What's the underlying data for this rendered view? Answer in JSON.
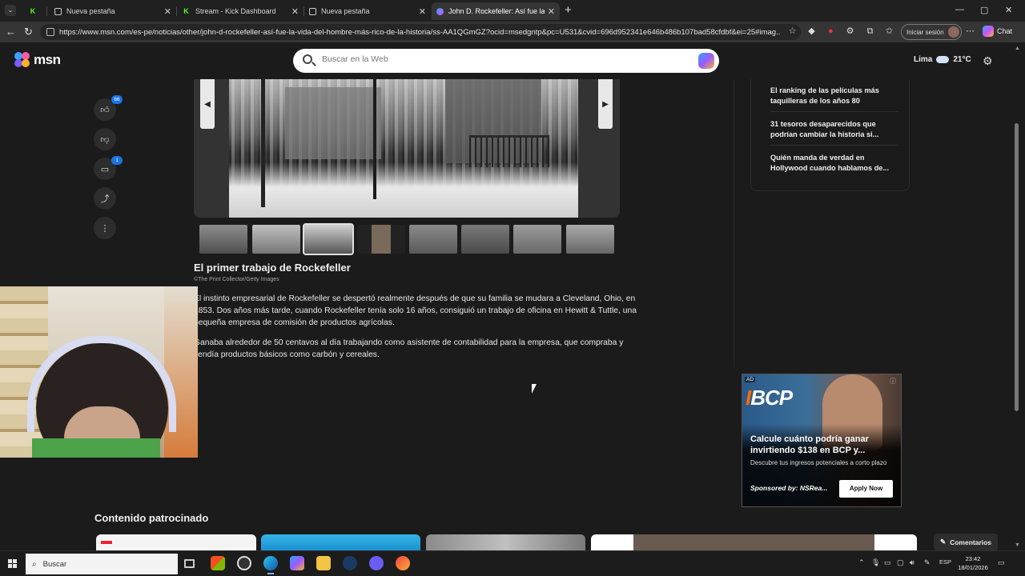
{
  "browser": {
    "tabs": [
      {
        "label": "",
        "active": false
      },
      {
        "label": "Nueva pestaña",
        "active": false
      },
      {
        "label": "Stream - Kick Dashboard",
        "active": false
      },
      {
        "label": "Nueva pestaña",
        "active": false
      },
      {
        "label": "John D. Rockefeller: Así fue la vida",
        "active": true
      }
    ],
    "url": "https://www.msn.com/es-pe/noticias/other/john-d-rockefeller-así-fue-la-vida-del-hombre-más-rico-de-la-historia/ss-AA1QGmGZ?ocid=msedgntp&pc=U531&cvid=696d952341e646b486b107bad58cfdbf&ei=25#imag...",
    "signin_label": "Iniciar sesión",
    "chat_label": "Chat"
  },
  "msn": {
    "logo_text": "msn",
    "search_placeholder": "Buscar en la Web",
    "weather_city": "Lima",
    "weather_temp": "21°C"
  },
  "actions": {
    "like_count": "66",
    "comment_count": "1"
  },
  "article": {
    "title": "El primer trabajo de Rockefeller",
    "credit": "©The Print Collector/Getty Images",
    "paragraphs": [
      "El instinto empresarial de Rockefeller se despertó realmente después de que su familia se mudara a Cleveland, Ohio, en 1853. Dos años más tarde, cuando Rockefeller tenía solo 16 años, consiguió un trabajo de oficina en Hewitt & Tuttle, una pequeña empresa de comisión de productos agrícolas.",
      "Ganaba alrededor de 50 centavos al día trabajando como asistente de contabilidad para la empresa, que compraba y vendía productos básicos como carbón y cereales."
    ]
  },
  "trending": [
    "El ranking de las películas más taquilleras de los años 80",
    "31 tesoros desaparecidos que podrían cambiar la historia si...",
    "Quién manda de verdad en Hollywood cuando hablamos de..."
  ],
  "ad": {
    "tag": "AD",
    "brand": "BCP",
    "headline": "Calcule cuánto podría ganar invirtiendo $138 en BCP y...",
    "description": "Descubre tus ingresos potenciales a corto plazo",
    "sponsor": "Sponsored by: NSRea...",
    "cta": "Apply Now"
  },
  "sponsored": {
    "heading": "Contenido patrocinado",
    "comments_label": "Comentarios"
  },
  "taskbar": {
    "search_placeholder": "Buscar",
    "lang": "ESP",
    "time": "23:42",
    "date": "18/01/2026"
  }
}
